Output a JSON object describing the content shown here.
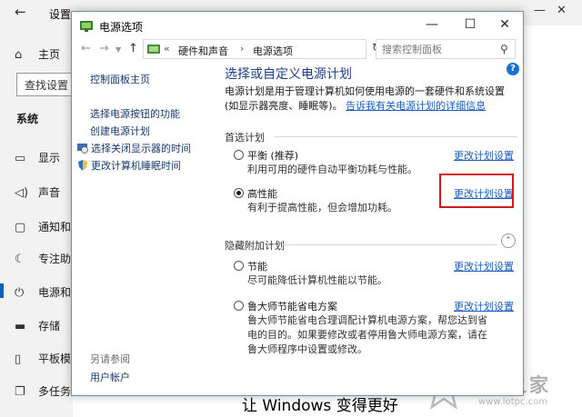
{
  "settings": {
    "title": "设置",
    "home": "主页",
    "search_button": "查找设置",
    "section": "系统",
    "items": [
      {
        "icon": "display-icon",
        "label": "显示"
      },
      {
        "icon": "sound-icon",
        "label": "声音"
      },
      {
        "icon": "notification-icon",
        "label": "通知和"
      },
      {
        "icon": "focus-assist-icon",
        "label": "专注助手"
      },
      {
        "icon": "power-icon",
        "label": "电源和"
      },
      {
        "icon": "storage-icon",
        "label": "存储"
      },
      {
        "icon": "tablet-icon",
        "label": "平板模式"
      },
      {
        "icon": "multitask-icon",
        "label": "多任务"
      }
    ],
    "footer_text": "让 Windows 变得更好"
  },
  "power_window": {
    "title": "电源选项",
    "breadcrumb": [
      "«",
      "硬件和声音",
      "›",
      "电源选项"
    ],
    "search_placeholder": "搜索控制面板",
    "left_pane": {
      "home_link": "控制面板主页",
      "links": [
        "选择电源按钮的功能",
        "创建电源计划"
      ],
      "icon_links": [
        "选择关闭显示器的时间",
        "更改计算机睡眠时间"
      ],
      "see_also": "另请参阅",
      "user_accounts": "用户帐户"
    },
    "main": {
      "heading": "选择或自定义电源计划",
      "description": "电源计划是用于管理计算机如何使用电源的一套硬件和系统设置(如显示器亮度、睡眠等)。",
      "description_link": "告诉我有关电源计划的详细信息",
      "preferred_label": "首选计划",
      "hidden_label": "隐藏附加计划",
      "plans": [
        {
          "name": "平衡 (推荐)",
          "desc": "利用可用的硬件自动平衡功耗与性能。",
          "link": "更改计划设置",
          "checked": false
        },
        {
          "name": "高性能",
          "desc": "有利于提高性能，但会增加功耗。",
          "link": "更改计划设置",
          "checked": true
        },
        {
          "name": "节能",
          "desc": "尽可能降低计算机性能以节能。",
          "link": "更改计划设置",
          "checked": false
        },
        {
          "name": "鲁大师节能省电方案",
          "desc": "鲁大师节能省电合理调配计算机电源方案，帮您达到省电的目的。如果要修改或者停用鲁大师电源方案，请在鲁大师程序中设置或修改。",
          "link": "更改计划设置",
          "checked": false
        }
      ]
    }
  },
  "watermark": {
    "text": "装机之家",
    "url": "www.lotpc.com"
  },
  "colors": {
    "accent": "#0063b1",
    "link": "#1a5dbf",
    "heading": "#1e3d8f",
    "highlight": "#d11a1a"
  }
}
